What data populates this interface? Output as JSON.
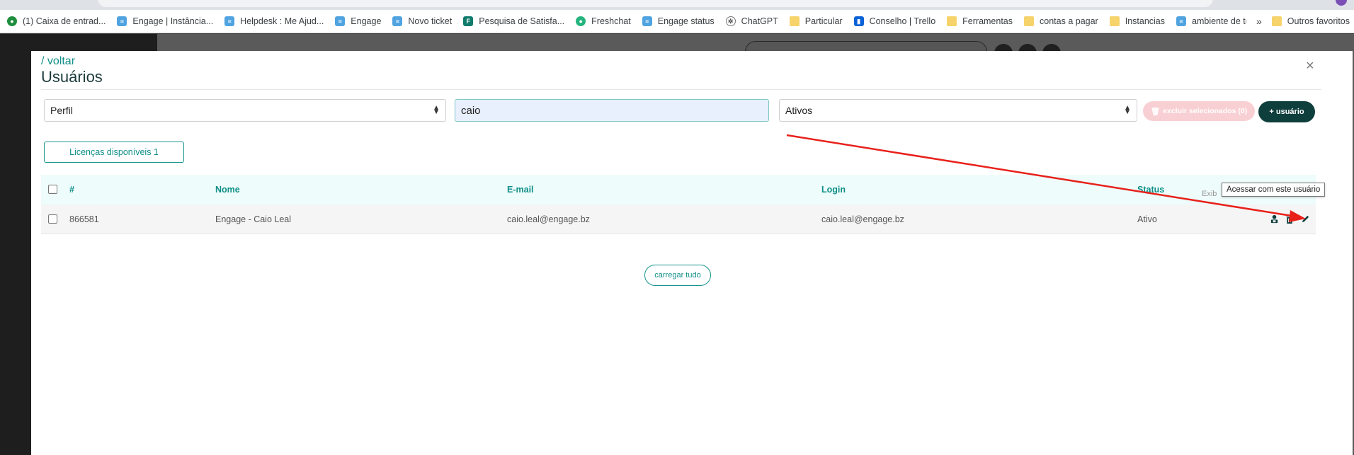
{
  "bookmarks": [
    {
      "label": "(1) Caixa de entrad...",
      "icon": "chat-icon"
    },
    {
      "label": "Engage | Instância...",
      "icon": "engage-icon"
    },
    {
      "label": "Helpdesk : Me Ajud...",
      "icon": "engage-icon"
    },
    {
      "label": "Engage",
      "icon": "engage-icon"
    },
    {
      "label": "Novo ticket",
      "icon": "engage-icon"
    },
    {
      "label": "Pesquisa de Satisfa...",
      "icon": "forms-icon"
    },
    {
      "label": "Freshchat",
      "icon": "freshchat-icon"
    },
    {
      "label": "Engage status",
      "icon": "engage-icon"
    },
    {
      "label": "ChatGPT",
      "icon": "chatgpt-icon"
    },
    {
      "label": "Particular",
      "icon": "folder-icon"
    },
    {
      "label": "Conselho | Trello",
      "icon": "trello-icon"
    },
    {
      "label": "Ferramentas",
      "icon": "folder-icon"
    },
    {
      "label": "contas a pagar",
      "icon": "folder-icon"
    },
    {
      "label": "Instancias",
      "icon": "folder-icon"
    },
    {
      "label": "ambiente de teste",
      "icon": "engage-icon"
    }
  ],
  "bookmarks_more": "»",
  "bookmarks_other": "Outros favoritos",
  "modal": {
    "back_link": "/ voltar",
    "title": "Usuários",
    "close": "×"
  },
  "filters": {
    "profile_select": "Perfil",
    "search_value": "caio",
    "status_select": "Ativos",
    "delete_selected": "excluir selecionados (0)",
    "add_user": "+ usuário"
  },
  "licenses_button": "Licenças disponíveis 1",
  "table": {
    "headers": {
      "id": "#",
      "name": "Nome",
      "email": "E-mail",
      "login": "Login",
      "status": "Status"
    },
    "rows": [
      {
        "id": "866581",
        "name": "Engage - Caio Leal",
        "email": "caio.leal@engage.bz",
        "login": "caio.leal@engage.bz",
        "status": "Ativo"
      }
    ]
  },
  "tooltip": "Acessar com este usuário",
  "exib_partial": "Exib",
  "load_all": "carregar tudo",
  "colors": {
    "accent": "#0f8f88",
    "dark": "#0f3f3d",
    "annotation_arrow": "#e8201a"
  }
}
